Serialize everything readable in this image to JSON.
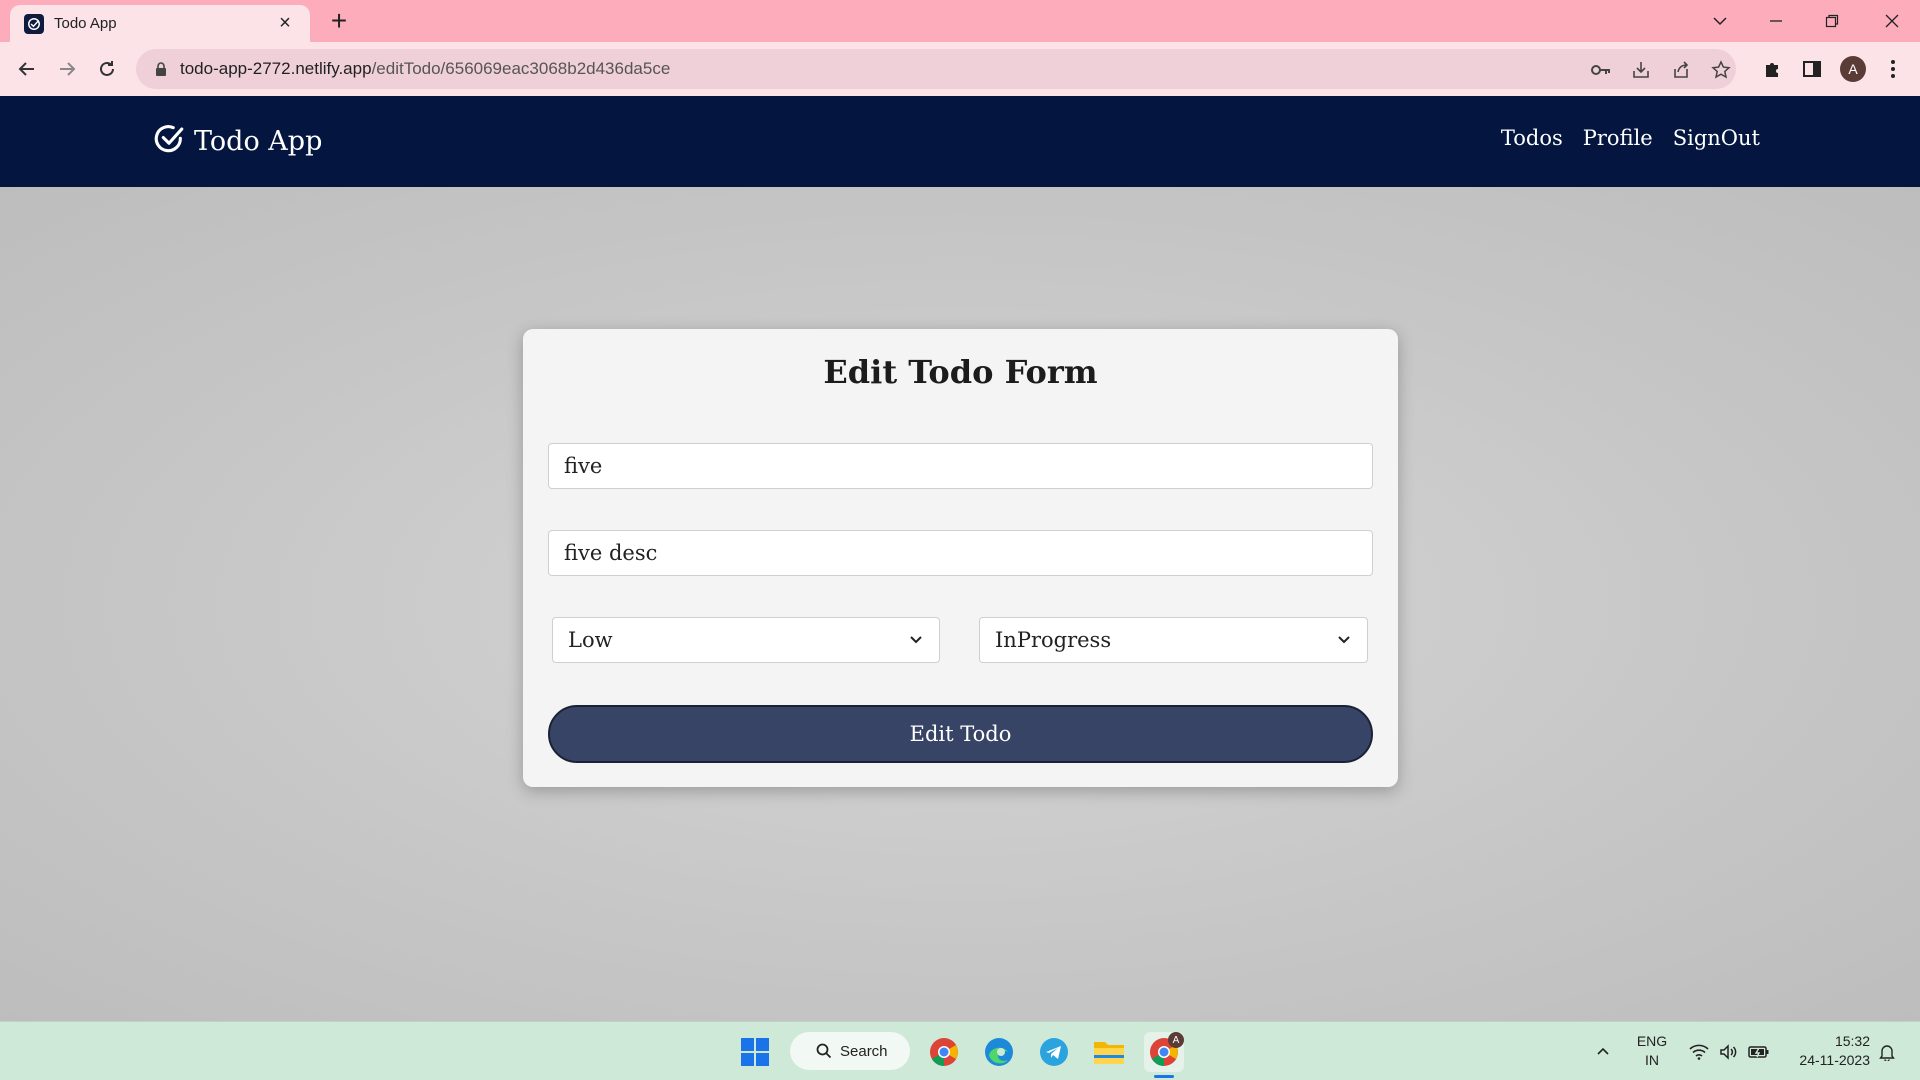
{
  "browser": {
    "tab_title": "Todo App",
    "url_host": "todo-app-2772.netlify.app",
    "url_path": "/editTodo/656069eac3068b2d436da5ce",
    "avatar_letter": "A"
  },
  "navbar": {
    "brand": "Todo App",
    "links": [
      "Todos",
      "Profile",
      "SignOut"
    ]
  },
  "form": {
    "title": "Edit Todo Form",
    "title_value": "five",
    "description_value": "five desc",
    "priority_selected": "Low",
    "status_selected": "InProgress",
    "submit_label": "Edit Todo"
  },
  "taskbar": {
    "search_label": "Search",
    "lang_line1": "ENG",
    "lang_line2": "IN",
    "time": "15:32",
    "date": "24-11-2023",
    "chrome_badge": "A"
  },
  "colors": {
    "tabbar": "#fdacbc",
    "navbar": "#041640",
    "button": "#374465",
    "taskbar": "#cfe9d8"
  }
}
